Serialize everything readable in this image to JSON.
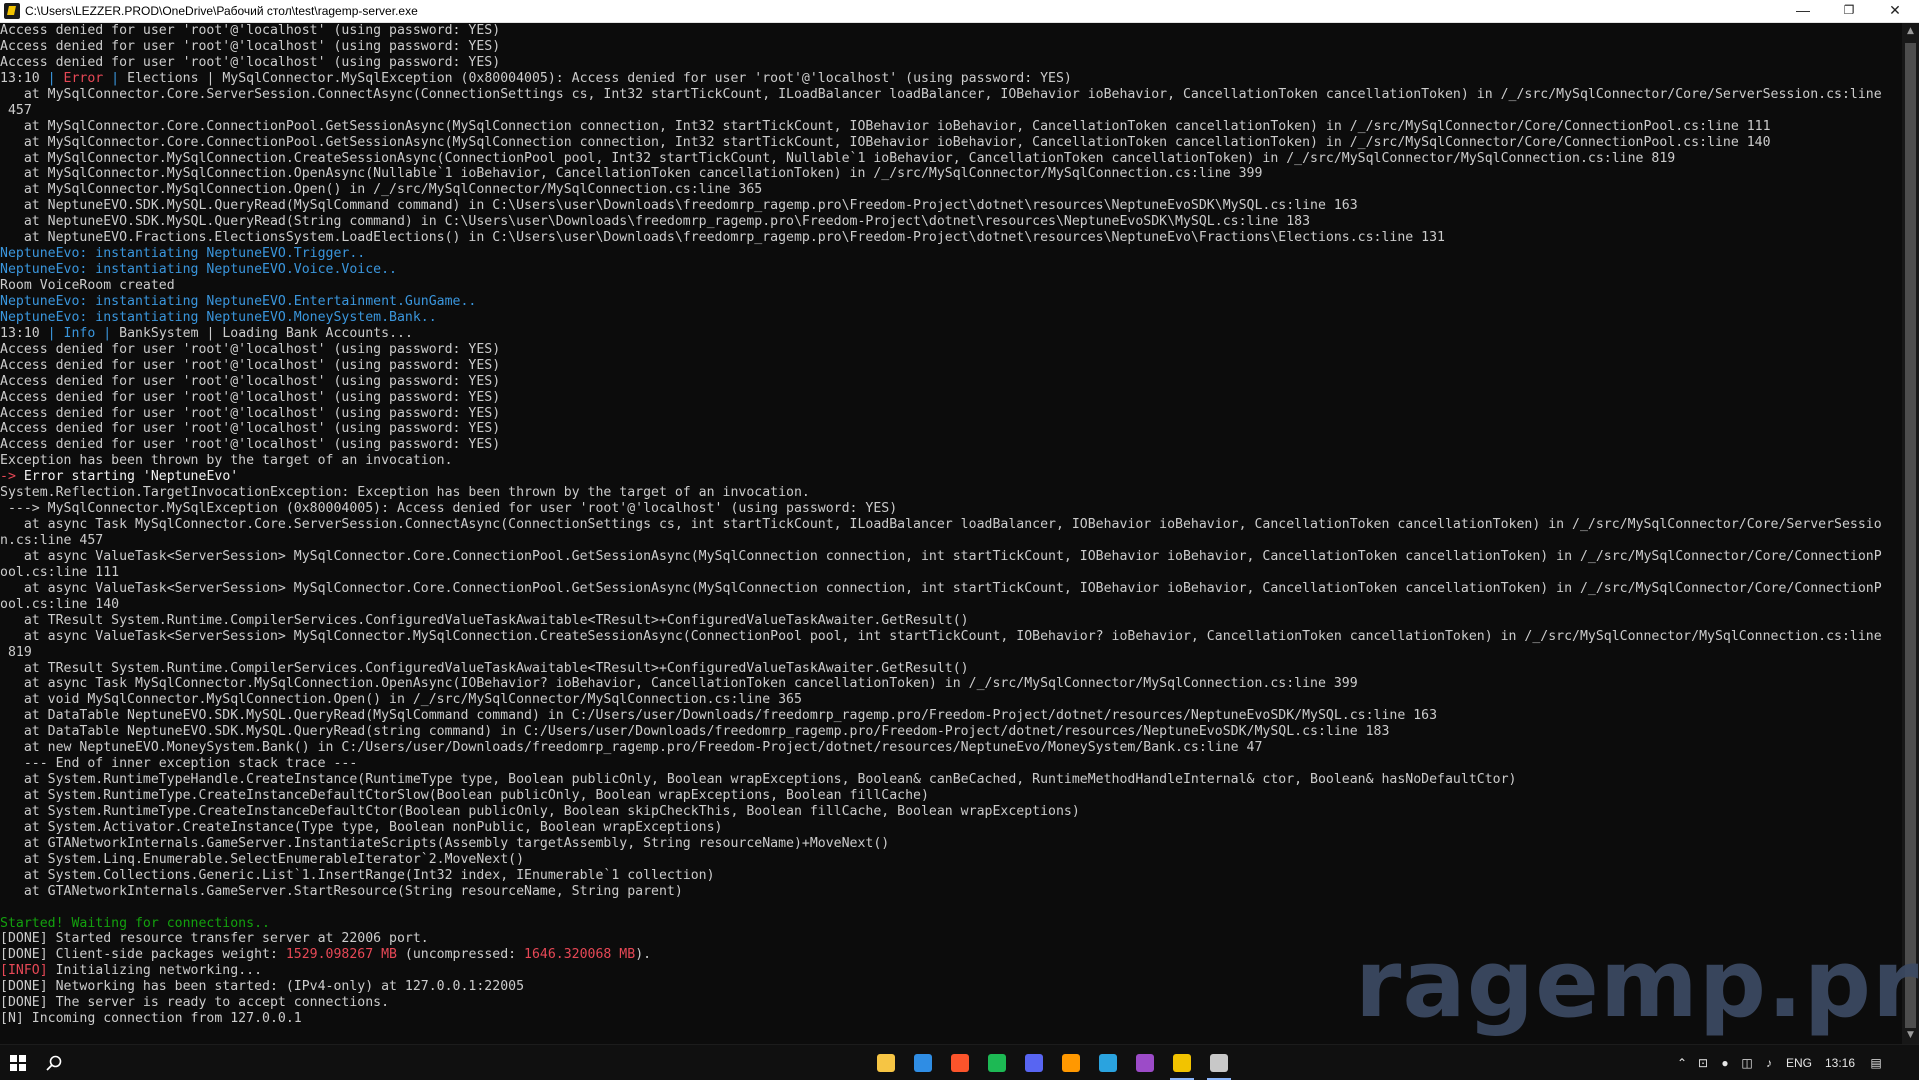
{
  "window": {
    "title": "C:\\Users\\LEZZER.PROD\\OneDrive\\Рабочий стол\\test\\ragemp-server.exe",
    "minimize_glyph": "—",
    "maximize_glyph": "❐",
    "close_glyph": "✕"
  },
  "console_lines": [
    [
      {
        "t": "Access denied for user 'root'@'localhost' (using password: YES)"
      }
    ],
    [
      {
        "t": "Access denied for user 'root'@'localhost' (using password: YES)"
      }
    ],
    [
      {
        "t": "Access denied for user 'root'@'localhost' (using password: YES)"
      }
    ],
    [
      {
        "t": "13:10 "
      },
      {
        "t": "| ",
        "c": "teal"
      },
      {
        "t": "Error",
        "c": "red"
      },
      {
        "t": " | ",
        "c": "teal"
      },
      {
        "t": "Elections | MySqlConnector.MySqlException (0x80004005): Access denied for user 'root'@'localhost' (using password: YES)"
      }
    ],
    [
      {
        "t": "   at MySqlConnector.Core.ServerSession.ConnectAsync(ConnectionSettings cs, Int32 startTickCount, ILoadBalancer loadBalancer, IOBehavior ioBehavior, CancellationToken cancellationToken) in /_/src/MySqlConnector/Core/ServerSession.cs:line"
      }
    ],
    [
      {
        "t": " 457"
      }
    ],
    [
      {
        "t": "   at MySqlConnector.Core.ConnectionPool.GetSessionAsync(MySqlConnection connection, Int32 startTickCount, IOBehavior ioBehavior, CancellationToken cancellationToken) in /_/src/MySqlConnector/Core/ConnectionPool.cs:line 111"
      }
    ],
    [
      {
        "t": "   at MySqlConnector.Core.ConnectionPool.GetSessionAsync(MySqlConnection connection, Int32 startTickCount, IOBehavior ioBehavior, CancellationToken cancellationToken) in /_/src/MySqlConnector/Core/ConnectionPool.cs:line 140"
      }
    ],
    [
      {
        "t": "   at MySqlConnector.MySqlConnection.CreateSessionAsync(ConnectionPool pool, Int32 startTickCount, Nullable`1 ioBehavior, CancellationToken cancellationToken) in /_/src/MySqlConnector/MySqlConnection.cs:line 819"
      }
    ],
    [
      {
        "t": "   at MySqlConnector.MySqlConnection.OpenAsync(Nullable`1 ioBehavior, CancellationToken cancellationToken) in /_/src/MySqlConnector/MySqlConnection.cs:line 399"
      }
    ],
    [
      {
        "t": "   at MySqlConnector.MySqlConnection.Open() in /_/src/MySqlConnector/MySqlConnection.cs:line 365"
      }
    ],
    [
      {
        "t": "   at NeptuneEVO.SDK.MySQL.QueryRead(MySqlCommand command) in C:\\Users\\user\\Downloads\\freedomrp_ragemp.pro\\Freedom-Project\\dotnet\\resources\\NeptuneEvoSDK\\MySQL.cs:line 163"
      }
    ],
    [
      {
        "t": "   at NeptuneEVO.SDK.MySQL.QueryRead(String command) in C:\\Users\\user\\Downloads\\freedomrp_ragemp.pro\\Freedom-Project\\dotnet\\resources\\NeptuneEvoSDK\\MySQL.cs:line 183"
      }
    ],
    [
      {
        "t": "   at NeptuneEVO.Fractions.ElectionsSystem.LoadElections() in C:\\Users\\user\\Downloads\\freedomrp_ragemp.pro\\Freedom-Project\\dotnet\\resources\\NeptuneEvo\\Fractions\\Elections.cs:line 131"
      }
    ],
    [
      {
        "t": "NeptuneEvo: instantiating NeptuneEVO.Trigger..",
        "c": "teal"
      }
    ],
    [
      {
        "t": "NeptuneEvo: instantiating NeptuneEVO.Voice.Voice..",
        "c": "teal"
      }
    ],
    [
      {
        "t": "Room VoiceRoom created"
      }
    ],
    [
      {
        "t": "NeptuneEvo: instantiating NeptuneEVO.Entertainment.GunGame..",
        "c": "teal"
      }
    ],
    [
      {
        "t": "NeptuneEvo: instantiating NeptuneEVO.MoneySystem.Bank..",
        "c": "teal"
      }
    ],
    [
      {
        "t": "13:10 "
      },
      {
        "t": "| ",
        "c": "teal"
      },
      {
        "t": "Info",
        "c": "teal"
      },
      {
        "t": " | ",
        "c": "teal"
      },
      {
        "t": "BankSystem | Loading Bank Accounts..."
      }
    ],
    [
      {
        "t": "Access denied for user 'root'@'localhost' (using password: YES)"
      }
    ],
    [
      {
        "t": "Access denied for user 'root'@'localhost' (using password: YES)"
      }
    ],
    [
      {
        "t": "Access denied for user 'root'@'localhost' (using password: YES)"
      }
    ],
    [
      {
        "t": "Access denied for user 'root'@'localhost' (using password: YES)"
      }
    ],
    [
      {
        "t": "Access denied for user 'root'@'localhost' (using password: YES)"
      }
    ],
    [
      {
        "t": "Access denied for user 'root'@'localhost' (using password: YES)"
      }
    ],
    [
      {
        "t": "Access denied for user 'root'@'localhost' (using password: YES)"
      }
    ],
    [
      {
        "t": "Exception has been thrown by the target of an invocation."
      }
    ],
    [
      {
        "t": "-> ",
        "c": "red"
      },
      {
        "t": "Error starting 'NeptuneEvo'",
        "c": "bright"
      }
    ],
    [
      {
        "t": "System.Reflection.TargetInvocationException: Exception has been thrown by the target of an invocation."
      }
    ],
    [
      {
        "t": " ---> MySqlConnector.MySqlException (0x80004005): Access denied for user 'root'@'localhost' (using password: YES)"
      }
    ],
    [
      {
        "t": "   at async Task MySqlConnector.Core.ServerSession.ConnectAsync(ConnectionSettings cs, int startTickCount, ILoadBalancer loadBalancer, IOBehavior ioBehavior, CancellationToken cancellationToken) in /_/src/MySqlConnector/Core/ServerSessio"
      }
    ],
    [
      {
        "t": "n.cs:line 457"
      }
    ],
    [
      {
        "t": "   at async ValueTask<ServerSession> MySqlConnector.Core.ConnectionPool.GetSessionAsync(MySqlConnection connection, int startTickCount, IOBehavior ioBehavior, CancellationToken cancellationToken) in /_/src/MySqlConnector/Core/ConnectionP"
      }
    ],
    [
      {
        "t": "ool.cs:line 111"
      }
    ],
    [
      {
        "t": "   at async ValueTask<ServerSession> MySqlConnector.Core.ConnectionPool.GetSessionAsync(MySqlConnection connection, int startTickCount, IOBehavior ioBehavior, CancellationToken cancellationToken) in /_/src/MySqlConnector/Core/ConnectionP"
      }
    ],
    [
      {
        "t": "ool.cs:line 140"
      }
    ],
    [
      {
        "t": "   at TResult System.Runtime.CompilerServices.ConfiguredValueTaskAwaitable<TResult>+ConfiguredValueTaskAwaiter.GetResult()"
      }
    ],
    [
      {
        "t": "   at async ValueTask<ServerSession> MySqlConnector.MySqlConnection.CreateSessionAsync(ConnectionPool pool, int startTickCount, IOBehavior? ioBehavior, CancellationToken cancellationToken) in /_/src/MySqlConnector/MySqlConnection.cs:line"
      }
    ],
    [
      {
        "t": " 819"
      }
    ],
    [
      {
        "t": "   at TResult System.Runtime.CompilerServices.ConfiguredValueTaskAwaitable<TResult>+ConfiguredValueTaskAwaiter.GetResult()"
      }
    ],
    [
      {
        "t": "   at async Task MySqlConnector.MySqlConnection.OpenAsync(IOBehavior? ioBehavior, CancellationToken cancellationToken) in /_/src/MySqlConnector/MySqlConnection.cs:line 399"
      }
    ],
    [
      {
        "t": "   at void MySqlConnector.MySqlConnection.Open() in /_/src/MySqlConnector/MySqlConnection.cs:line 365"
      }
    ],
    [
      {
        "t": "   at DataTable NeptuneEVO.SDK.MySQL.QueryRead(MySqlCommand command) in C:/Users/user/Downloads/freedomrp_ragemp.pro/Freedom-Project/dotnet/resources/NeptuneEvoSDK/MySQL.cs:line 163"
      }
    ],
    [
      {
        "t": "   at DataTable NeptuneEVO.SDK.MySQL.QueryRead(string command) in C:/Users/user/Downloads/freedomrp_ragemp.pro/Freedom-Project/dotnet/resources/NeptuneEvoSDK/MySQL.cs:line 183"
      }
    ],
    [
      {
        "t": "   at new NeptuneEVO.MoneySystem.Bank() in C:/Users/user/Downloads/freedomrp_ragemp.pro/Freedom-Project/dotnet/resources/NeptuneEvo/MoneySystem/Bank.cs:line 47"
      }
    ],
    [
      {
        "t": "   --- End of inner exception stack trace ---"
      }
    ],
    [
      {
        "t": "   at System.RuntimeTypeHandle.CreateInstance(RuntimeType type, Boolean publicOnly, Boolean wrapExceptions, Boolean& canBeCached, RuntimeMethodHandleInternal& ctor, Boolean& hasNoDefaultCtor)"
      }
    ],
    [
      {
        "t": "   at System.RuntimeType.CreateInstanceDefaultCtorSlow(Boolean publicOnly, Boolean wrapExceptions, Boolean fillCache)"
      }
    ],
    [
      {
        "t": "   at System.RuntimeType.CreateInstanceDefaultCtor(Boolean publicOnly, Boolean skipCheckThis, Boolean fillCache, Boolean wrapExceptions)"
      }
    ],
    [
      {
        "t": "   at System.Activator.CreateInstance(Type type, Boolean nonPublic, Boolean wrapExceptions)"
      }
    ],
    [
      {
        "t": "   at GTANetworkInternals.GameServer.InstantiateScripts(Assembly targetAssembly, String resourceName)+MoveNext()"
      }
    ],
    [
      {
        "t": "   at System.Linq.Enumerable.SelectEnumerableIterator`2.MoveNext()"
      }
    ],
    [
      {
        "t": "   at System.Collections.Generic.List`1.InsertRange(Int32 index, IEnumerable`1 collection)"
      }
    ],
    [
      {
        "t": "   at GTANetworkInternals.GameServer.StartResource(String resourceName, String parent)"
      }
    ],
    [
      {
        "t": ""
      }
    ],
    [
      {
        "t": "Started! Waiting for connections..",
        "c": "green"
      }
    ],
    [
      {
        "t": "[DONE] Started resource transfer server at 22006 port."
      }
    ],
    [
      {
        "t": "[DONE] Client-side packages weight: "
      },
      {
        "t": "1529.098267 MB",
        "c": "red"
      },
      {
        "t": " (uncompressed: "
      },
      {
        "t": "1646.320068 MB",
        "c": "red"
      },
      {
        "t": ")."
      }
    ],
    [
      {
        "t": "[INFO]",
        "c": "red"
      },
      {
        "t": " Initializing networking..."
      }
    ],
    [
      {
        "t": "[DONE] Networking has been started: (IPv4-only) at 127.0.0.1:22005"
      }
    ],
    [
      {
        "t": "[DONE] The server is ready to accept connections."
      }
    ],
    [
      {
        "t": "[N] Incoming connection from 127.0.0.1"
      }
    ]
  ],
  "watermark": "ragemp.pro",
  "taskbar": {
    "apps": [
      {
        "name": "file-explorer",
        "color": "#f6c544"
      },
      {
        "name": "vscode",
        "color": "#2f8de4"
      },
      {
        "name": "brave",
        "color": "#fb542b"
      },
      {
        "name": "spotify",
        "color": "#1db954"
      },
      {
        "name": "discord",
        "color": "#5865f2"
      },
      {
        "name": "sublime",
        "color": "#ff9800"
      },
      {
        "name": "telegram",
        "color": "#2aa3df"
      },
      {
        "name": "winrar",
        "color": "#9c4bc8"
      },
      {
        "name": "ragemp-server",
        "color": "#f2c300"
      },
      {
        "name": "terminal",
        "color": "#c8c8c8"
      }
    ],
    "language": "ENG",
    "time": "13:16"
  }
}
